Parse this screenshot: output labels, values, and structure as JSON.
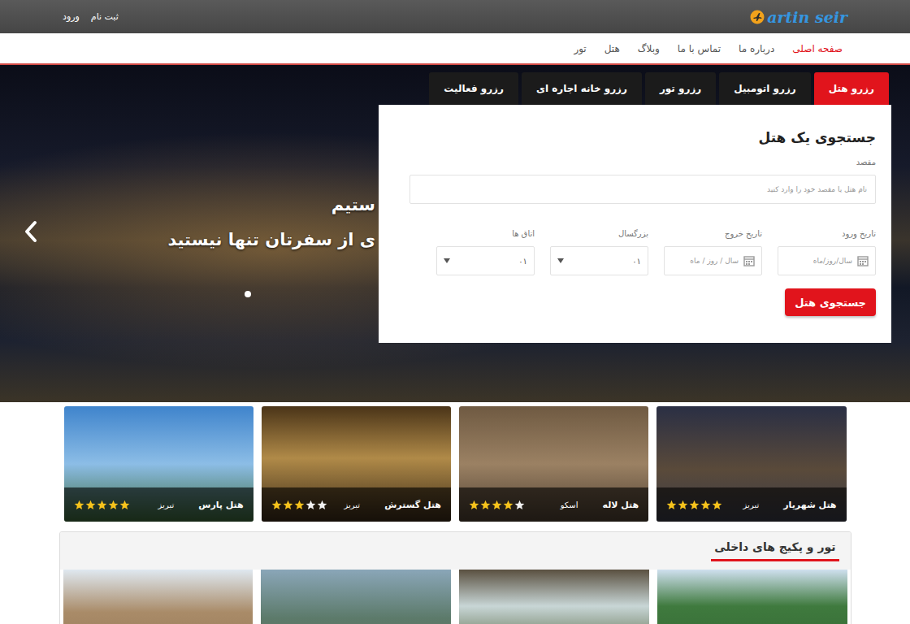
{
  "topbar": {
    "logo": "artin seir",
    "links": [
      "ثبت نام",
      "ورود"
    ]
  },
  "nav": [
    {
      "label": "صفحه اصلی",
      "selected": true
    },
    {
      "label": "درباره ما",
      "selected": false
    },
    {
      "label": "تماس با ما",
      "selected": false
    },
    {
      "label": "وبلاگ",
      "selected": false
    },
    {
      "label": "هتل",
      "selected": false
    },
    {
      "label": "تور",
      "selected": false
    }
  ],
  "hero": {
    "caption_lines": [
      "ستیم",
      "ی از سفرتان تنها نیستید"
    ]
  },
  "booking_tabs": [
    {
      "label": "رزرو هتل",
      "selected": true
    },
    {
      "label": "رزرو اتومبیل",
      "selected": false
    },
    {
      "label": "رزرو تور",
      "selected": false
    },
    {
      "label": "رزرو خانه اجاره ای",
      "selected": false
    },
    {
      "label": "رزرو فعالیت",
      "selected": false
    }
  ],
  "search": {
    "title": "جستجوی یک هتل",
    "destination": {
      "label": "مقصد",
      "placeholder": "نام هتل یا مقصد خود را وارد کنید"
    },
    "fields": [
      {
        "label": "تاریخ ورود",
        "kind": "date",
        "text": "سال/روز/ماه"
      },
      {
        "label": "تاریخ خروج",
        "kind": "date",
        "text": "سال / روز / ماه"
      },
      {
        "label": "بزرگسال",
        "kind": "select",
        "text": "۰۱"
      },
      {
        "label": "اتاق ها",
        "kind": "select",
        "text": "۰۱"
      }
    ],
    "button": "جستجوی هتل"
  },
  "hotels": [
    {
      "name": "هتل شهریار",
      "city": "تبریز",
      "stars": 5
    },
    {
      "name": "هتل لاله",
      "city": "اسکو",
      "stars": 4
    },
    {
      "name": "هتل گسترش",
      "city": "تبریز",
      "stars": 3
    },
    {
      "name": "هتل پارس",
      "city": "تبریز",
      "stars": 5
    }
  ],
  "tours": {
    "title": "تور و پکیج های داخلی"
  }
}
